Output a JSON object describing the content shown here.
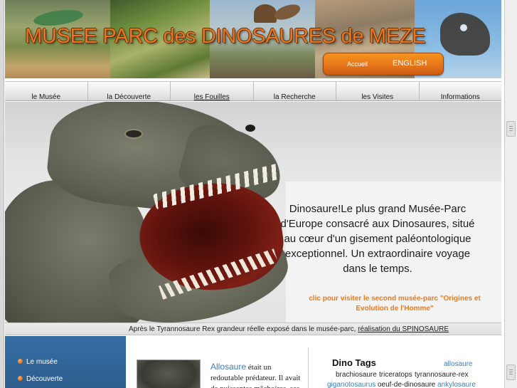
{
  "header": {
    "title": "MUSEE PARC des DINOSAURES de MEZE",
    "lang": {
      "accueil": "Accueil",
      "english": "ENGLISH"
    }
  },
  "nav": {
    "items": [
      {
        "label": "le Musée"
      },
      {
        "label": "la Découverte"
      },
      {
        "label": "les Fouilles"
      },
      {
        "label": "la Recherche"
      },
      {
        "label": "les Visites"
      },
      {
        "label": "Informations"
      }
    ]
  },
  "hero": {
    "text": "Dinosaure!Le plus grand Musée-Parc d'Europe consacré aux Dinosaures, situé au cœur d'un gisement paléontologique exceptionnel. Un extraordinaire voyage dans le temps.",
    "link": "clic pour visiter le second musée-parc \"Origines et Evolution de l'Homme\""
  },
  "caption": {
    "text": "Après le Tyrannosaure Rex grandeur réelle exposé dans le musée-parc, ",
    "link": "réalisation du SPINOSAURE"
  },
  "sidebar": {
    "items": [
      {
        "label": "Le musée"
      },
      {
        "label": "Découverte"
      }
    ]
  },
  "article": {
    "title": "Allosaure",
    "text": " était un redoutable prédateur. Il avait de puissantes mâchoires, ses"
  },
  "tags": {
    "title": "Dino Tags",
    "items": [
      "allosaure",
      "brachiosaure",
      "triceratops",
      "tyrannosaure-rex",
      "giganotosaurus",
      "oeuf-de-dinosaure",
      "ankylosaure"
    ]
  },
  "colors": {
    "accent_orange": "#e87722",
    "sidebar_blue": "#2f6596",
    "link_blue": "#3c7fc0"
  }
}
